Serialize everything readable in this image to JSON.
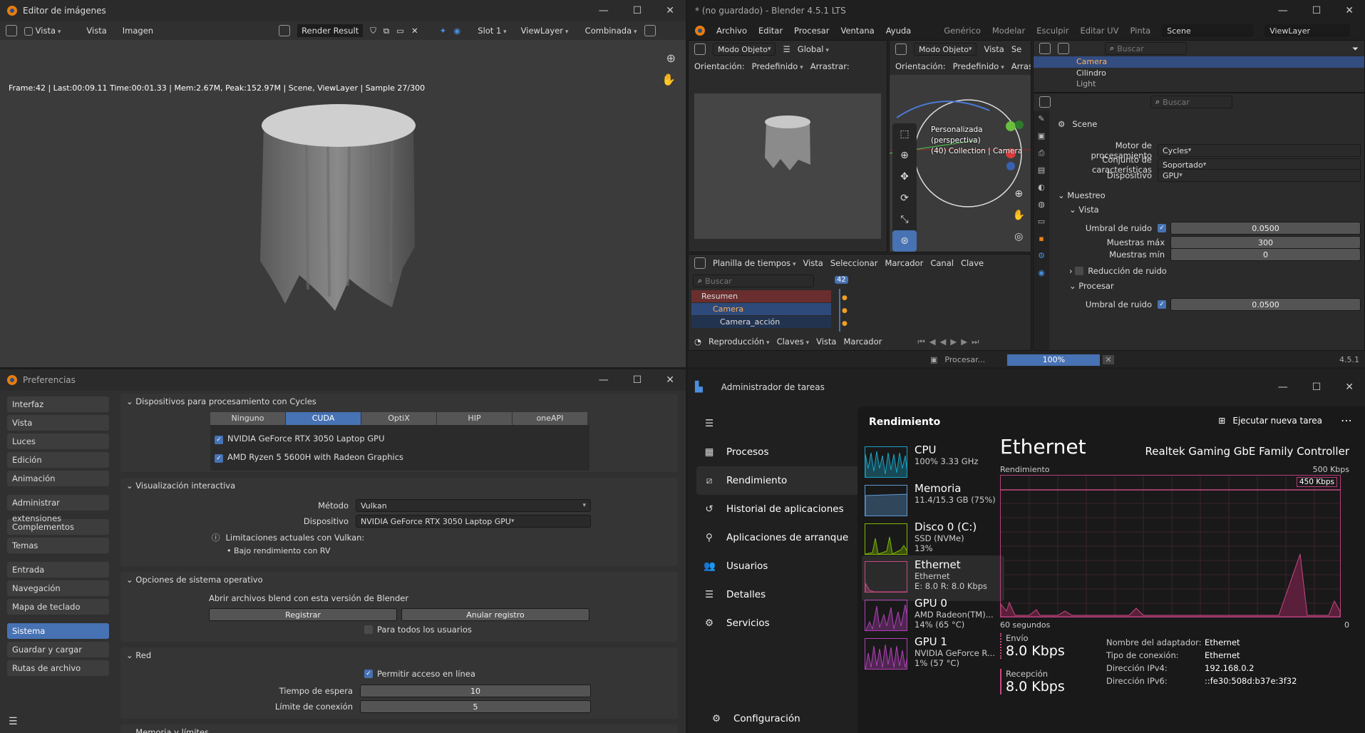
{
  "image_editor": {
    "title": "Editor de imágenes",
    "header": {
      "view_menu": "Vista",
      "menu_vista": "Vista",
      "menu_imagen": "Imagen",
      "image_name": "Render Result",
      "slot": "Slot 1",
      "viewlayer": "ViewLayer",
      "pass": "Combinada"
    },
    "info_line": "Frame:42 | Last:00:09.11 Time:00:01.33 | Mem:2.67M, Peak:152.97M | Scene, ViewLayer | Sample 27/300"
  },
  "blender_main": {
    "title": "* (no guardado) - Blender 4.5.1 LTS",
    "menu": [
      "Archivo",
      "Editar",
      "Procesar",
      "Ventana",
      "Ayuda"
    ],
    "workspaces": [
      "Genérico",
      "Modelar",
      "Esculpir",
      "Editar UV",
      "Pinta"
    ],
    "scene": "Scene",
    "viewlayer": "ViewLayer",
    "viewport_left": {
      "mode": "Modo Objeto",
      "orientation_label": "Orientación:",
      "orientation": "Predefinido",
      "drag_label": "Arrastrar:",
      "transform": "Global"
    },
    "viewport_right": {
      "mode": "Modo Objeto",
      "menu_vista": "Vista",
      "menu_sel": "Se",
      "orientation_label": "Orientación:",
      "orientation": "Predefinido",
      "drag_label": "Arrastra",
      "overlay_line1": "Personalizada (perspectiva)",
      "overlay_line2": "(40) Collection | Camera"
    },
    "outliner": {
      "search": "Buscar",
      "items": [
        "Camera",
        "Cilindro",
        "Light"
      ]
    },
    "properties": {
      "search": "Buscar",
      "scene": "Scene",
      "engine_label": "Motor de procesamiento",
      "engine": "Cycles",
      "feature_label": "Conjunto de características",
      "feature": "Soportado",
      "device_label": "Dispositivo",
      "device": "GPU",
      "sampling": "Muestreo",
      "viewport": "Vista",
      "noise_label": "Umbral de ruido",
      "noise": "0.0500",
      "max_label": "Muestras máx",
      "max": "300",
      "min_label": "Muestras mín",
      "min": "0",
      "denoise": "Reducción de ruido",
      "render": "Procesar",
      "noise2_label": "Umbral de ruido",
      "noise2": "0.0500"
    },
    "timeline": {
      "editor": "Planilla de tiempos",
      "menus": [
        "Vista",
        "Seleccionar",
        "Marcador",
        "Canal",
        "Clave"
      ],
      "search": "Buscar",
      "frame": "42",
      "rows": [
        "Resumen",
        "Camera",
        "Camera_acción"
      ],
      "footer": [
        "Reproducción",
        "Claves",
        "Vista",
        "Marcador"
      ]
    },
    "status": {
      "task": "Procesar...",
      "progress_text": "100%",
      "progress": 1.0,
      "version": "4.5.1"
    }
  },
  "prefs": {
    "title": "Preferencias",
    "sidebar": [
      [
        "Interfaz",
        "Vista",
        "Luces",
        "Edición",
        "Animación"
      ],
      [
        "Administrar extensiones"
      ],
      [
        "Complementos",
        "Temas"
      ],
      [
        "Entrada",
        "Navegación",
        "Mapa de teclado"
      ],
      [
        "Sistema",
        "Guardar y cargar",
        "Rutas de archivo"
      ]
    ],
    "cycles_panel": "Dispositivos para procesamiento con Cycles",
    "tabs": [
      "Ninguno",
      "CUDA",
      "OptiX",
      "HIP",
      "oneAPI"
    ],
    "devices": [
      "NVIDIA GeForce RTX 3050 Laptop GPU",
      "AMD Ryzen 5 5600H with Radeon Graphics"
    ],
    "viz_panel": "Visualización interactiva",
    "method_label": "Método",
    "method": "Vulkan",
    "dev_label": "Dispositivo",
    "dev": "NVIDIA GeForce RTX 3050 Laptop GPU",
    "limits": "Limitaciones actuales con Vulkan:",
    "limit1": "• Bajo rendimiento con RV",
    "os_panel": "Opciones de sistema operativo",
    "open_blend": "Abrir archivos blend con esta versión de Blender",
    "register": "Registrar",
    "unregister": "Anular registro",
    "all_users": "Para todos los usuarios",
    "net_panel": "Red",
    "online": "Permitir acceso en línea",
    "timeout_label": "Tiempo de espera",
    "timeout": "10",
    "conn_label": "Límite de conexión",
    "conn": "5",
    "mem_panel": "Memoria y límites"
  },
  "task_manager": {
    "title": "Administrador de tareas",
    "nav": [
      "Procesos",
      "Rendimiento",
      "Historial de aplicaciones",
      "Aplicaciones de arranque",
      "Usuarios",
      "Detalles",
      "Servicios"
    ],
    "settings": "Configuración",
    "heading": "Rendimiento",
    "new_task": "Ejecutar nueva tarea",
    "perf": [
      {
        "name": "CPU",
        "l1": "100%  3.33 GHz",
        "l2": "",
        "color": "#17a2c6"
      },
      {
        "name": "Memoria",
        "l1": "11.4/15.3 GB (75%)",
        "l2": "",
        "color": "#5d9bd6"
      },
      {
        "name": "Disco 0 (C:)",
        "l1": "SSD (NVMe)",
        "l2": "13%",
        "color": "#7fba00"
      },
      {
        "name": "Ethernet",
        "l1": "Ethernet",
        "l2": "E: 8.0 R: 8.0 Kbps",
        "color": "#c64a82"
      },
      {
        "name": "GPU 0",
        "l1": "AMD Radeon(TM)...",
        "l2": "14% (65 °C)",
        "color": "#b13fb8"
      },
      {
        "name": "GPU 1",
        "l1": "NVIDIA GeForce R...",
        "l2": "1% (57 °C)",
        "color": "#b13fb8"
      }
    ],
    "detail": {
      "title": "Ethernet",
      "adapter_title": "Realtek Gaming GbE Family Controller",
      "rend": "Rendimiento",
      "max": "500 Kbps",
      "scale": "450 Kbps",
      "time_left": "60 segundos",
      "time_right": "0",
      "send_label": "Envío",
      "send": "8.0 Kbps",
      "recv_label": "Recepción",
      "recv": "8.0 Kbps",
      "k1": "Nombre del adaptador:",
      "v1": "Ethernet",
      "k2": "Tipo de conexión:",
      "v2": "Ethernet",
      "k3": "Dirección IPv4:",
      "v3": "192.168.0.2",
      "k4": "Dirección IPv6:",
      "v4": "::fe30:508d:b37e:3f32"
    }
  }
}
